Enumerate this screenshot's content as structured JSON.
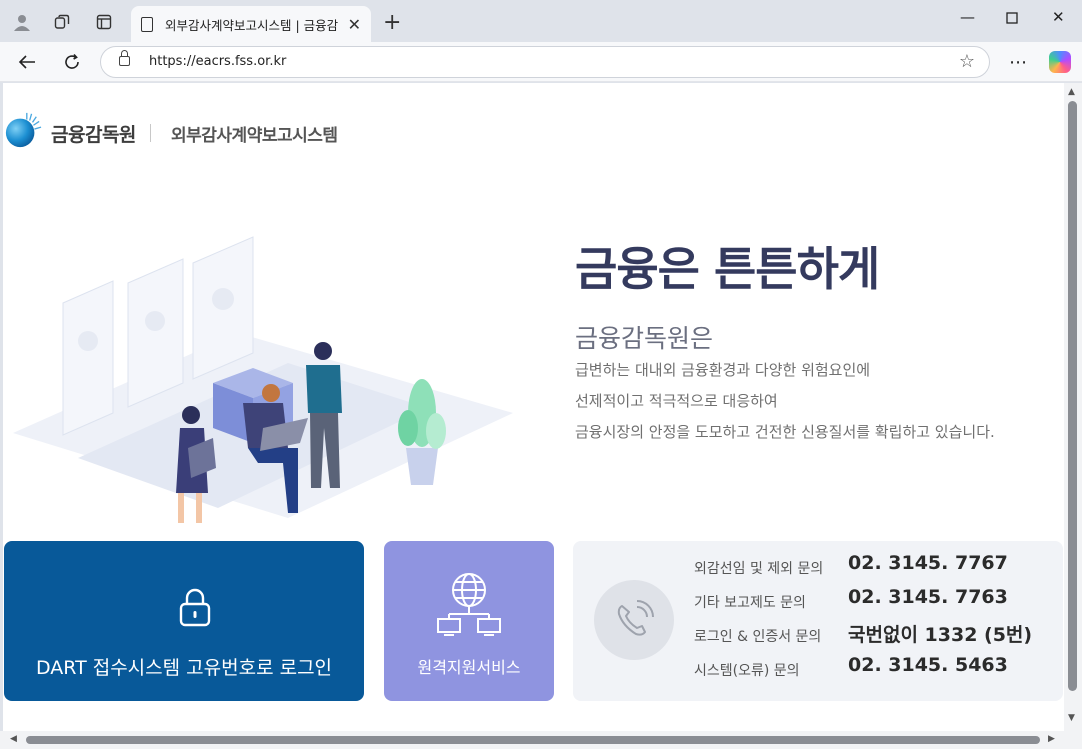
{
  "browser": {
    "tab_title": "외부감사계약보고시스템 | 금융감",
    "url": "https://eacrs.fss.or.kr"
  },
  "header": {
    "logo_text": "금융감독원",
    "system_name": "외부감사계약보고시스템"
  },
  "hero": {
    "title": "금융은 튼튼하게",
    "subtitle": "금융감독원은",
    "lines": [
      "급변하는 대내외 금융환경과 다양한 위험요인에",
      "선제적이고 적극적으로 대응하여",
      "금융시장의 안정을 도모하고 건전한 신용질서를 확립하고 있습니다."
    ]
  },
  "cards": {
    "dart_login": "DART 접수시스템 고유번호로 로그인",
    "remote_support": "원격지원서비스"
  },
  "contacts": [
    {
      "label": "외감선임 및 제외 문의",
      "value": "02. 3145. 7767"
    },
    {
      "label": "기타 보고제도 문의",
      "value": "02. 3145. 7763"
    },
    {
      "label": "로그인 & 인증서 문의",
      "value": "국번없이 1332 (5번)"
    },
    {
      "label": "시스템(오류) 문의",
      "value": "02. 3145. 5463"
    }
  ],
  "colors": {
    "dart_card": "#085999",
    "remote_card": "#8f94e0",
    "hero_title": "#343a5e"
  }
}
